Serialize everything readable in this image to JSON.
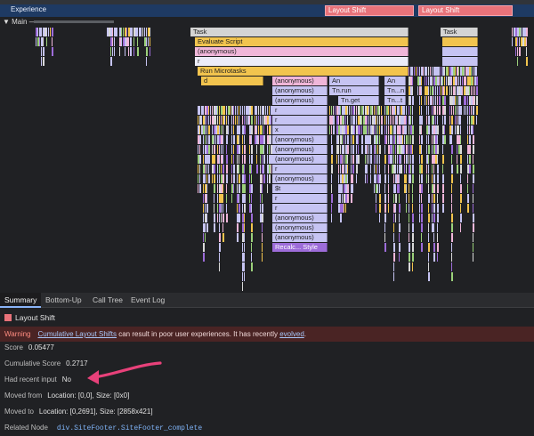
{
  "tracks": {
    "experience_label": "Experience",
    "layout_shift_1": "Layout Shift",
    "layout_shift_2": "Layout Shift",
    "main_label": "▼ Main —"
  },
  "flame": {
    "task_1": "Task",
    "task_2": "Task",
    "evaluate_script": "Evaluate Script",
    "anonymous_top": "(anonymous)",
    "r_top": "r",
    "run_microtasks": "Run Microtasks",
    "d": "d",
    "column": [
      "(anonymous)",
      "(anonymous)",
      "(anonymous)",
      "r",
      "r",
      "x",
      "(anonymous)",
      "(anonymous)",
      "(anonymous)",
      "r",
      "(anonymous)",
      "$t",
      "r",
      "r",
      "(anonymous)",
      "(anonymous)",
      "(anonymous)",
      "Recalc... Style"
    ],
    "an_1": "An",
    "tn_run": "Tn.run",
    "tn_get": "Tn.get",
    "an_2": "An",
    "tn_n": "Tn...n",
    "tn_t": "Tn...t"
  },
  "tabs": {
    "summary": "Summary",
    "bottom_up": "Bottom-Up",
    "call_tree": "Call Tree",
    "event_log": "Event Log"
  },
  "summary": {
    "title": "Layout Shift",
    "warning_label": "Warning",
    "warning_link": "Cumulative Layout Shifts",
    "warning_text": " can result in poor user experiences. It has recently ",
    "warning_link2": "evolved",
    "warning_end": ".",
    "score_label": "Score",
    "score_value": "0.05477",
    "cumulative_label": "Cumulative Score",
    "cumulative_value": "0.2717",
    "recent_input_label": "Had recent input",
    "recent_input_value": "No",
    "moved_from_label": "Moved from",
    "moved_from_value": "Location: [0,0], Size: [0x0]",
    "moved_to_label": "Moved to",
    "moved_to_value": "Location: [0,2691], Size: [2858x421]",
    "related_node_label": "Related Node",
    "related_node_value": "div.SiteFooter.SiteFooter_complete"
  },
  "colors": {
    "layout_shift": "#e8727a",
    "experience_track": "#1e3a63",
    "script": "#f2c44e",
    "function": "#c6c4f3",
    "rendering": "#9d6cd9",
    "arrow": "#e8417a"
  }
}
